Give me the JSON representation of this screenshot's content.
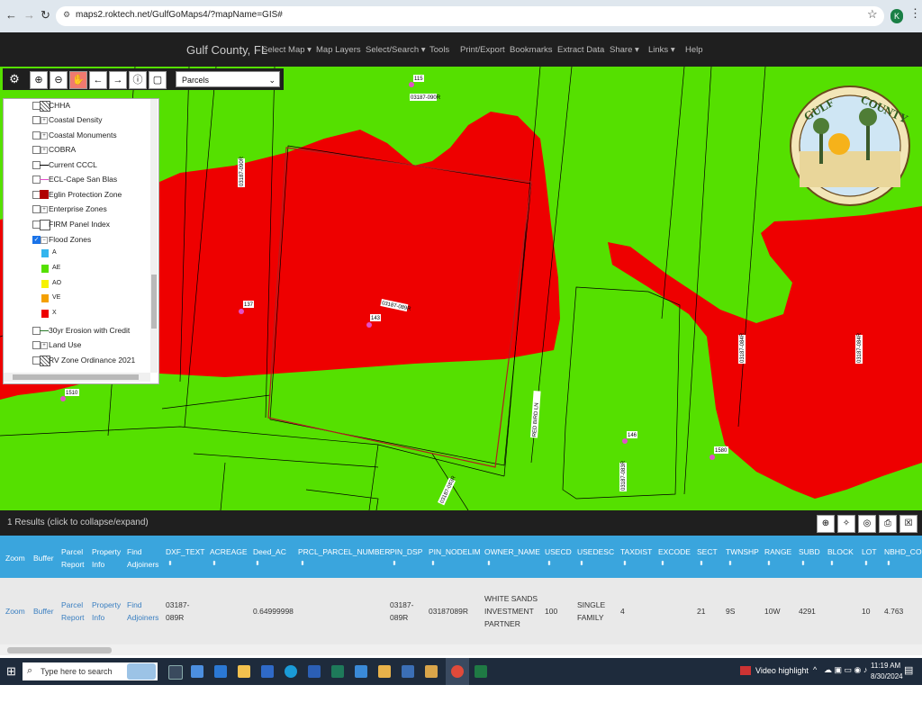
{
  "browser": {
    "url": "maps2.roktech.net/GulfGoMaps4/?mapName=GIS#",
    "profile_initial": "K"
  },
  "app": {
    "title": "Gulf County, FL",
    "nav": [
      "Select Map ▾",
      "Map Layers",
      "Select/Search ▾",
      "Tools",
      "Print/Export",
      "Bookmarks",
      "Extract Data",
      "Share ▾",
      "Links ▾",
      "Help"
    ]
  },
  "toolbar": {
    "parcel_select": "Parcels"
  },
  "layers": [
    {
      "label": "CHHA",
      "checked": false,
      "type": "hatch"
    },
    {
      "label": "Coastal Density",
      "checked": false,
      "type": "expand"
    },
    {
      "label": "Coastal Monuments",
      "checked": false,
      "type": "expand"
    },
    {
      "label": "COBRA",
      "checked": false,
      "type": "expand"
    },
    {
      "label": "Current CCCL",
      "checked": false,
      "type": "line-black"
    },
    {
      "label": "ECL-Cape San Blas",
      "checked": false,
      "type": "line-pink"
    },
    {
      "label": "Eglin Protection Zone",
      "checked": false,
      "type": "fill-darkred"
    },
    {
      "label": "Enterprise Zones",
      "checked": false,
      "type": "expand"
    },
    {
      "label": "FIRM Panel Index",
      "checked": false,
      "type": "box"
    },
    {
      "label": "Flood Zones",
      "checked": true,
      "type": "collapse"
    }
  ],
  "flood_legend": [
    {
      "label": "A",
      "color": "#33b5ee"
    },
    {
      "label": "AE",
      "color": "#55e000"
    },
    {
      "label": "AO",
      "color": "#f6f200"
    },
    {
      "label": "VE",
      "color": "#f4a000"
    },
    {
      "label": "X",
      "color": "#ee0000"
    }
  ],
  "layers_after": [
    {
      "label": "30yr Erosion with Credit",
      "checked": false,
      "type": "line-green"
    },
    {
      "label": "Land Use",
      "checked": false,
      "type": "expand"
    },
    {
      "label": "RV Zone Ordinance 2021",
      "checked": false,
      "type": "hatch"
    }
  ],
  "map_labels": {
    "addr_115": "115",
    "addr_137": "137",
    "addr_143": "143",
    "addr_1510": "1510",
    "addr_146": "146",
    "addr_1580": "1580",
    "street": "RED BIRD LN",
    "parcel_089r": "03187-089R",
    "parcel_090r": "03187-090R",
    "parcel_084r": "03187-084R",
    "parcel_083r": "03187-083R"
  },
  "results": {
    "summary": "1 Results (click to collapse/expand)",
    "headers": [
      "Zoom",
      "Buffer",
      "Parcel Report",
      "Property Info",
      "Find Adjoiners",
      "DXF_TEXT",
      "ACREAGE",
      "Deed_AC",
      "PRCL_PARCEL_NUMBER",
      "PIN_DSP",
      "PIN_NODELIM",
      "OWNER_NAME",
      "USECD",
      "USEDESC",
      "TAXDIST",
      "EXCODE",
      "SECT",
      "TWNSHP",
      "RANGE",
      "SUBD",
      "BLOCK",
      "LOT",
      "NBHD_COD"
    ],
    "row": {
      "zoom": "Zoom",
      "buffer": "Buffer",
      "parcel_report": "Parcel Report",
      "property_info": "Property Info",
      "find_adjoiners": "Find Adjoiners",
      "dxf_text": "03187-089R",
      "acreage": "",
      "deed_ac": "0.64999998",
      "prcl_parcel_number": "",
      "pin_dsp": "03187-089R",
      "pin_nodelim": "03187089R",
      "owner_name": "WHITE SANDS INVESTMENT PARTNER",
      "usecd": "100",
      "usedesc": "SINGLE FAMILY",
      "taxdist": "4",
      "excode": "",
      "sect": "21",
      "twnshp": "9S",
      "range": "10W",
      "subd": "4291",
      "block": "",
      "lot": "10",
      "nbhd_cod": "4.763"
    }
  },
  "taskbar": {
    "search_placeholder": "Type here to search",
    "video_highlight": "Video highlight",
    "time": "11:19 AM",
    "date": "8/30/2024"
  }
}
